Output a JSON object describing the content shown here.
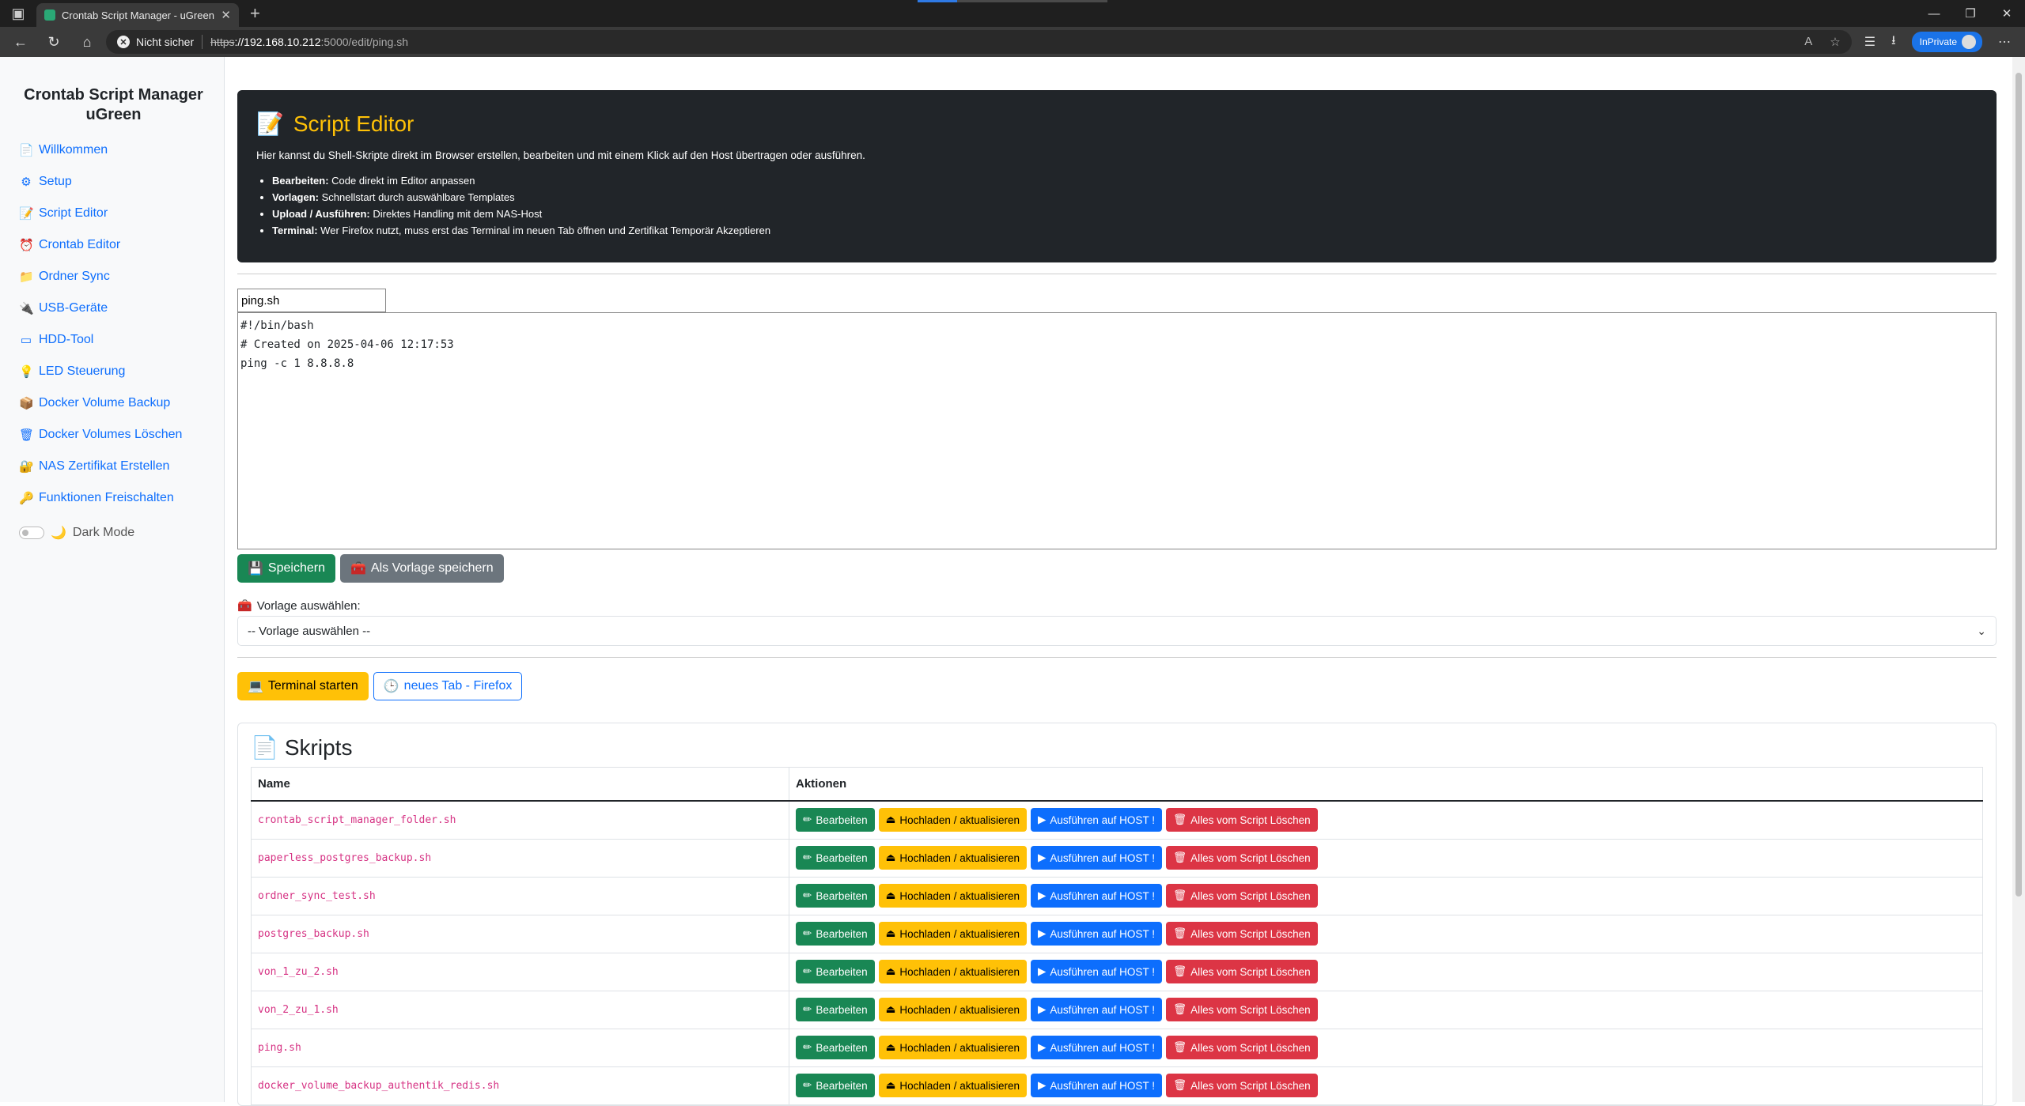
{
  "browser": {
    "tab_title": "Crontab Script Manager - uGreen",
    "security_label": "Nicht sicher",
    "url_scheme": "https",
    "url_host": "://192.168.10.212",
    "url_path": ":5000/edit/ping.sh",
    "inprivate_label": "InPrivate"
  },
  "sidebar": {
    "title": "Crontab Script Manager uGreen",
    "items": [
      {
        "icon": "📄",
        "label": "Willkommen"
      },
      {
        "icon": "⚙",
        "label": "Setup"
      },
      {
        "icon": "📝",
        "label": "Script Editor"
      },
      {
        "icon": "⏰",
        "label": "Crontab Editor"
      },
      {
        "icon": "📁",
        "label": "Ordner Sync"
      },
      {
        "icon": "🔌",
        "label": "USB-Geräte"
      },
      {
        "icon": "▭",
        "label": "HDD-Tool"
      },
      {
        "icon": "💡",
        "label": "LED Steuerung"
      },
      {
        "icon": "📦",
        "label": "Docker Volume Backup"
      },
      {
        "icon": "🗑",
        "label": "Docker Volumes Löschen"
      },
      {
        "icon": "🔐",
        "label": "NAS Zertifikat Erstellen"
      },
      {
        "icon": "🔑",
        "label": "Funktionen Freischalten"
      }
    ],
    "dark_mode_label": "Dark Mode"
  },
  "hero": {
    "title": "Script Editor",
    "intro": "Hier kannst du Shell-Skripte direkt im Browser erstellen, bearbeiten und mit einem Klick auf den Host übertragen oder ausführen.",
    "bullets": [
      {
        "bold": "Bearbeiten:",
        "text": " Code direkt im Editor anpassen"
      },
      {
        "bold": "Vorlagen:",
        "text": " Schnellstart durch auswählbare Templates"
      },
      {
        "bold": "Upload / Ausführen:",
        "text": " Direktes Handling mit dem NAS-Host"
      },
      {
        "bold": "Terminal:",
        "text": " Wer Firefox nutzt, muss erst das Terminal im neuen Tab öffnen und Zertifikat Temporär Akzeptieren"
      }
    ]
  },
  "editor": {
    "filename": "ping.sh",
    "content": "#!/bin/bash\n# Created on 2025-04-06 12:17:53\nping -c 1 8.8.8.8",
    "save_label": "Speichern",
    "save_template_label": "Als Vorlage speichern",
    "template_label": "Vorlage auswählen:",
    "template_selected": "-- Vorlage auswählen --"
  },
  "terminal": {
    "start_label": "Terminal starten",
    "newtab_label": "neues Tab - Firefox"
  },
  "scripts": {
    "title": "Skripts",
    "col_name": "Name",
    "col_actions": "Aktionen",
    "btn_edit": "Bearbeiten",
    "btn_upload": "Hochladen / aktualisieren",
    "btn_run": "Ausführen auf HOST !",
    "btn_delete": "Alles vom Script Löschen",
    "rows": [
      "crontab_script_manager_folder.sh",
      "paperless_postgres_backup.sh",
      "ordner_sync_test.sh",
      "postgres_backup.sh",
      "von_1_zu_2.sh",
      "von_2_zu_1.sh",
      "ping.sh",
      "docker_volume_backup_authentik_redis.sh"
    ]
  }
}
